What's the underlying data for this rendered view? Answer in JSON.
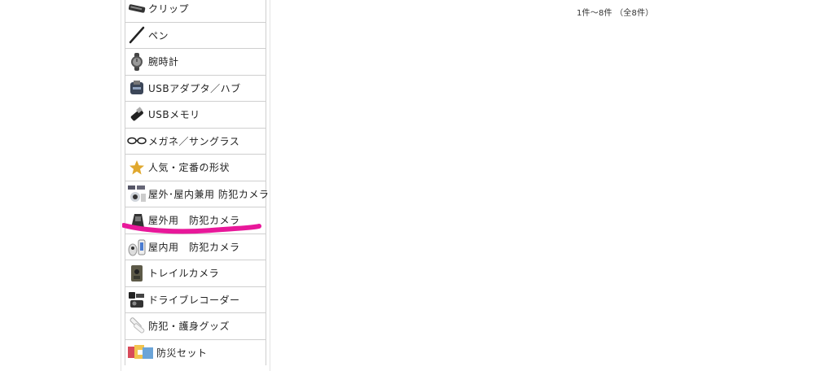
{
  "sidebar": {
    "items": [
      {
        "label": "クリップ",
        "icon": "clip-icon"
      },
      {
        "label": "ペン",
        "icon": "pen-icon"
      },
      {
        "label": "腕時計",
        "icon": "wristwatch-icon"
      },
      {
        "label": "USBアダプタ／ハブ",
        "icon": "usb-adapter-icon"
      },
      {
        "label": "USBメモリ",
        "icon": "usb-memory-icon"
      },
      {
        "label": "メガネ／サングラス",
        "icon": "glasses-icon"
      },
      {
        "label": "人気・定番の形状",
        "icon": "star-icon"
      },
      {
        "label": "屋外･屋内兼用 防犯カメラ",
        "icon": "indoor-outdoor-camera-icon"
      },
      {
        "label": "屋外用　防犯カメラ",
        "icon": "outdoor-camera-icon"
      },
      {
        "label": "屋内用　防犯カメラ",
        "icon": "indoor-camera-icon"
      },
      {
        "label": "トレイルカメラ",
        "icon": "trail-camera-icon"
      },
      {
        "label": "ドライブレコーダー",
        "icon": "dashcam-icon"
      },
      {
        "label": "防犯・護身グッズ",
        "icon": "security-goods-icon"
      },
      {
        "label": "防災セット",
        "icon": "disaster-kit-icon"
      }
    ]
  },
  "results": {
    "count_text": "1件～8件 （全8件）"
  },
  "annotation": {
    "highlight_color": "#e8189a"
  }
}
